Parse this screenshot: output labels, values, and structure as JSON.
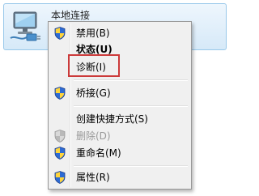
{
  "connection": {
    "name": "本地连接",
    "icon": "network-adapter-icon"
  },
  "menu": {
    "items": [
      {
        "label": "禁用(B)",
        "icon": "uac-shield-icon"
      },
      {
        "label": "状态(U)",
        "emphasis": "bold"
      },
      {
        "label": "诊断(I)",
        "highlighted": true
      },
      {
        "label": "桥接(G)",
        "icon": "uac-shield-icon"
      },
      {
        "label": "创建快捷方式(S)"
      },
      {
        "label": "删除(D)",
        "icon": "uac-shield-icon",
        "disabled": true
      },
      {
        "label": "重命名(M)",
        "icon": "uac-shield-icon"
      },
      {
        "label": "属性(R)",
        "icon": "uac-shield-icon"
      }
    ],
    "highlight_color": "#cc3a3a"
  }
}
